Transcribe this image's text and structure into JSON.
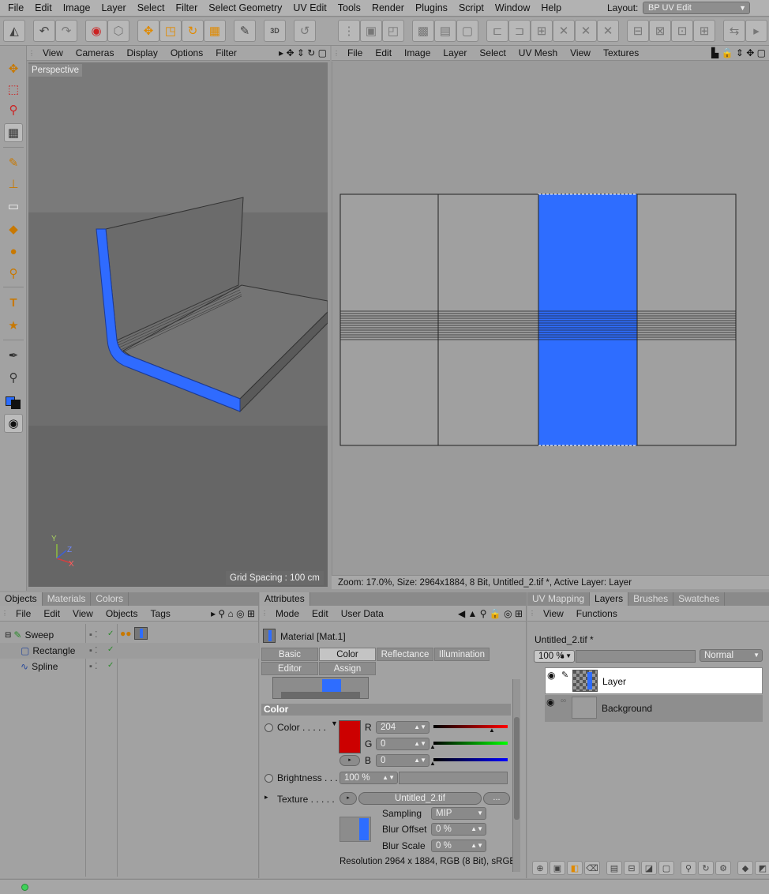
{
  "menubar": {
    "items": [
      "File",
      "Edit",
      "Image",
      "Layer",
      "Select",
      "Filter",
      "Select Geometry",
      "UV Edit",
      "Tools",
      "Render",
      "Plugins",
      "Script",
      "Window",
      "Help"
    ],
    "layout_label": "Layout:",
    "layout_value": "BP UV Edit"
  },
  "toolbar": {
    "undo_icon": "undo-icon",
    "redo_icon": "redo-icon",
    "badge_3d": "3D"
  },
  "viewport": {
    "menu": [
      "View",
      "Cameras",
      "Display",
      "Options",
      "Filter"
    ],
    "label": "Perspective",
    "grid_spacing": "Grid Spacing : 100 cm",
    "axis_y": "Y",
    "axis_z": "Z",
    "axis_x": "X",
    "colors": {
      "blue": "#2f6bff",
      "bg_light": "#7a7a7a",
      "bg_dark": "#656565"
    }
  },
  "uv": {
    "menu": [
      "File",
      "Edit",
      "Image",
      "Layer",
      "Select",
      "UV Mesh",
      "View",
      "Textures"
    ],
    "status": "Zoom: 17.0%, Size: 2964x1884, 8 Bit, Untitled_2.tif *, Active Layer: Layer",
    "highlight_color": "#2e6dff"
  },
  "objects": {
    "tabs": [
      "Objects",
      "Materials",
      "Colors"
    ],
    "menu": [
      "File",
      "Edit",
      "View",
      "Objects",
      "Tags"
    ],
    "tree": [
      {
        "name": "Sweep",
        "icon": "sweep-icon"
      },
      {
        "name": "Rectangle",
        "icon": "rectangle-icon"
      },
      {
        "name": "Spline",
        "icon": "spline-icon"
      }
    ]
  },
  "attributes": {
    "tab": "Attributes",
    "menu": [
      "Mode",
      "Edit",
      "User Data"
    ],
    "material_title": "Material [Mat.1]",
    "segments_row1": [
      "Basic",
      "Color",
      "Reflectance",
      "Illumination"
    ],
    "segments_row2": [
      "Editor",
      "Assign"
    ],
    "section": "Color",
    "color_label": "Color . . . . .",
    "r_label": "R",
    "r_value": "204",
    "g_label": "G",
    "g_value": "0",
    "b_label": "B",
    "b_value": "0",
    "swatch_color": "#cc0000",
    "brightness_label": "Brightness . . .",
    "brightness_value": "100 %",
    "texture_label": "Texture . . . . .",
    "texture_file": "Untitled_2.tif",
    "texture_more": "...",
    "sampling_label": "Sampling",
    "sampling_value": "MIP",
    "blur_offset_label": "Blur Offset",
    "blur_offset_value": "0 %",
    "blur_scale_label": "Blur Scale",
    "blur_scale_value": "0 %",
    "resolution": "Resolution 2964 x 1884, RGB (8 Bit), sRGB"
  },
  "layers_panel": {
    "tabs": [
      "UV Mapping",
      "Layers",
      "Brushes",
      "Swatches"
    ],
    "menu": [
      "View",
      "Functions"
    ],
    "file_name": "Untitled_2.tif *",
    "opacity": "100 %",
    "blend_mode": "Normal",
    "layers": [
      {
        "name": "Layer"
      },
      {
        "name": "Background"
      }
    ]
  }
}
